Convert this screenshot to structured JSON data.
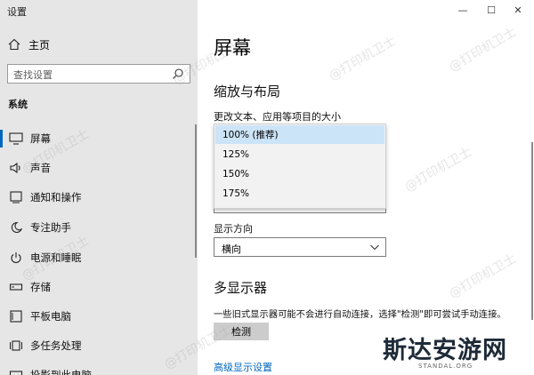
{
  "app_title": "设置",
  "sidebar": {
    "home_label": "主页",
    "search_placeholder": "查找设置",
    "section_label": "系统",
    "items": [
      {
        "label": "屏幕",
        "icon": "monitor-icon"
      },
      {
        "label": "声音",
        "icon": "speaker-icon"
      },
      {
        "label": "通知和操作",
        "icon": "notification-icon"
      },
      {
        "label": "专注助手",
        "icon": "moon-icon"
      },
      {
        "label": "电源和睡眠",
        "icon": "power-icon"
      },
      {
        "label": "存储",
        "icon": "storage-icon"
      },
      {
        "label": "平板电脑",
        "icon": "tablet-icon"
      },
      {
        "label": "多任务处理",
        "icon": "multitask-icon"
      },
      {
        "label": "投影到此电脑",
        "icon": "projector-icon"
      }
    ],
    "active_item": "屏幕"
  },
  "window": {
    "controls": {
      "minimize": "—",
      "maximize": "☐",
      "close": "✕"
    }
  },
  "main": {
    "title": "屏幕",
    "scale_heading": "缩放与布局",
    "scale_label": "更改文本、应用等项目的大小",
    "scale_options": [
      "100% (推荐)",
      "125%",
      "150%",
      "175%"
    ],
    "scale_selected": "100% (推荐)",
    "orientation_label": "显示方向",
    "orientation_value": "横向",
    "multi_heading": "多显示器",
    "multi_desc": "一些旧式显示器可能不会进行自动连接，选择\"检测\"即可尝试手动连接。",
    "detect_button": "检测",
    "advanced_link": "高级显示设置"
  },
  "watermark": {
    "logo_text": "斯达安游网",
    "logo_sub": "STANDAL.ORG",
    "repeated_text": "@打印机卫士"
  },
  "colors": {
    "sidebar_bg": "#e6e6e6",
    "accent": "#0067c0",
    "selected_option_bg": "#cce4f7"
  }
}
